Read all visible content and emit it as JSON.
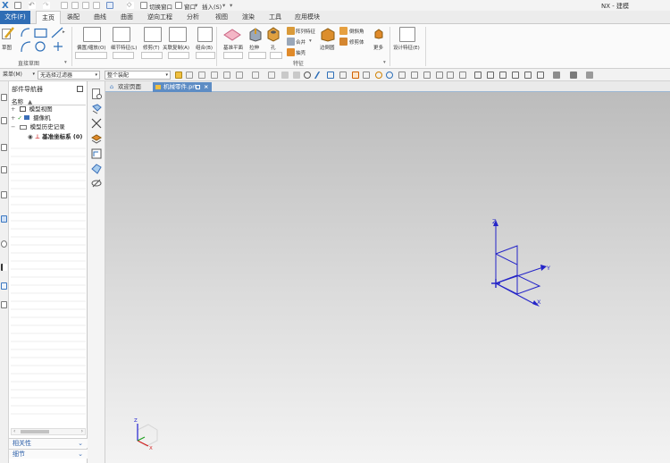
{
  "app": {
    "logo": "X",
    "title": "NX - 建模"
  },
  "quick_access": {
    "switch_window": "切换窗口",
    "window": "窗口",
    "insert": "插入(S)"
  },
  "ribbon_tabs": {
    "file": "文件(F)",
    "tabs": [
      "主页",
      "装配",
      "曲线",
      "曲面",
      "逆向工程",
      "分析",
      "视图",
      "渲染",
      "工具",
      "应用模块"
    ],
    "active_index": 0
  },
  "ribbon": {
    "sketch": "草图",
    "direct_sketch": "直接草图",
    "offset_scale": "偏置/缩放(O)",
    "detail_feature": "细节特征(L)",
    "trim": "修剪(T)",
    "associative_copy": "关联复制(A)",
    "combine": "组合(B)",
    "datum_plane": "基准平面",
    "extrude": "拉伸",
    "hole": "孔",
    "pattern_feature": "阵列特征",
    "unite": "合并",
    "shell": "抽壳",
    "edge_blend": "边倒圆",
    "chamfer": "倒斜角",
    "trim_body": "修剪体",
    "more": "更多",
    "feature_group": "特征",
    "design_feature": "设计特征(E)"
  },
  "command_bar": {
    "menu": "菜单(M)",
    "filter": "无选择过滤器",
    "scope": "整个装配"
  },
  "navigator": {
    "title": "部件导航器",
    "col_name": "名称",
    "tree": [
      "模型视图",
      "摄像机",
      "模型历史记录",
      "基准坐标系 (0)"
    ],
    "sections": [
      "相关性",
      "细节"
    ]
  },
  "doc_tabs": {
    "welcome": "欢迎页面",
    "part": "机械零件.prt"
  },
  "viewport": {
    "csys_axes": [
      "Z",
      "Y",
      "X"
    ],
    "triad_axes": [
      "Z",
      "X"
    ]
  },
  "colors": {
    "accent": "#2f6db5",
    "csys": "#2424c8",
    "axis_x": "#d22020",
    "axis_y": "#20a020",
    "axis_z": "#2020d0"
  }
}
